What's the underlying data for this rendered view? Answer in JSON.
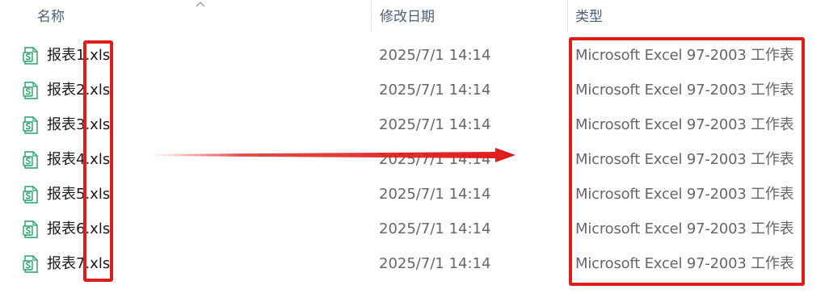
{
  "header": {
    "name_label": "名称",
    "date_label": "修改日期",
    "type_label": "类型"
  },
  "files": [
    {
      "name": "报表1.xls",
      "date": "2025/7/1 14:14",
      "type": "Microsoft Excel 97-2003 工作表"
    },
    {
      "name": "报表2.xls",
      "date": "2025/7/1 14:14",
      "type": "Microsoft Excel 97-2003 工作表"
    },
    {
      "name": "报表3.xls",
      "date": "2025/7/1 14:14",
      "type": "Microsoft Excel 97-2003 工作表"
    },
    {
      "name": "报表4.xls",
      "date": "2025/7/1 14:14",
      "type": "Microsoft Excel 97-2003 工作表"
    },
    {
      "name": "报表5.xls",
      "date": "2025/7/1 14:14",
      "type": "Microsoft Excel 97-2003 工作表"
    },
    {
      "name": "报表6.xls",
      "date": "2025/7/1 14:14",
      "type": "Microsoft Excel 97-2003 工作表"
    },
    {
      "name": "报表7.xls",
      "date": "2025/7/1 14:14",
      "type": "Microsoft Excel 97-2003 工作表"
    }
  ],
  "icons": {
    "file_icon": "excel-sheet-icon",
    "sort_icon": "sort-ascending-chevron-icon"
  },
  "colors": {
    "annotation_red": "#e01b1b",
    "excel_green": "#21a366",
    "header_text": "#4c607a"
  }
}
